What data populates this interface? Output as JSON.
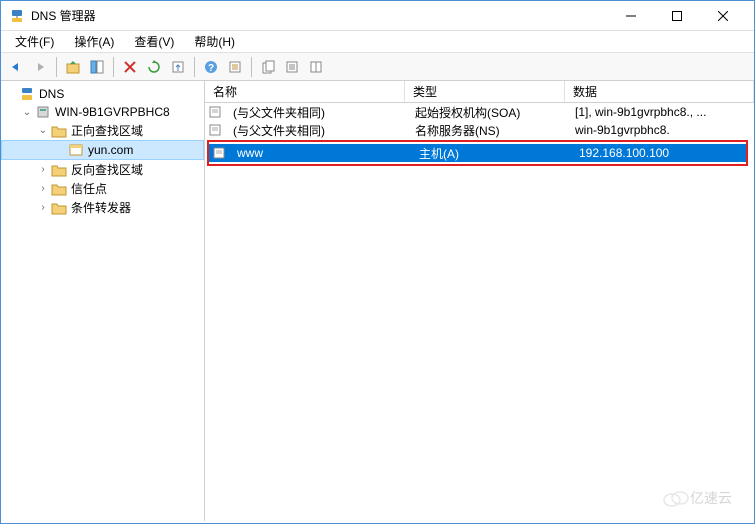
{
  "window": {
    "title": "DNS 管理器"
  },
  "menu": {
    "file": "文件(F)",
    "action": "操作(A)",
    "view": "查看(V)",
    "help": "帮助(H)"
  },
  "tree": {
    "root": "DNS",
    "server": "WIN-9B1GVRPBHC8",
    "fwd_zone": "正向查找区域",
    "domain": "yun.com",
    "rev_zone": "反向查找区域",
    "trust": "信任点",
    "cond_fwd": "条件转发器"
  },
  "columns": {
    "name": "名称",
    "type": "类型",
    "data": "数据"
  },
  "rows": [
    {
      "name": "(与父文件夹相同)",
      "type": "起始授权机构(SOA)",
      "data": "[1], win-9b1gvrpbhc8., ..."
    },
    {
      "name": "(与父文件夹相同)",
      "type": "名称服务器(NS)",
      "data": "win-9b1gvrpbhc8."
    },
    {
      "name": "www",
      "type": "主机(A)",
      "data": "192.168.100.100"
    }
  ],
  "watermark": "亿速云"
}
